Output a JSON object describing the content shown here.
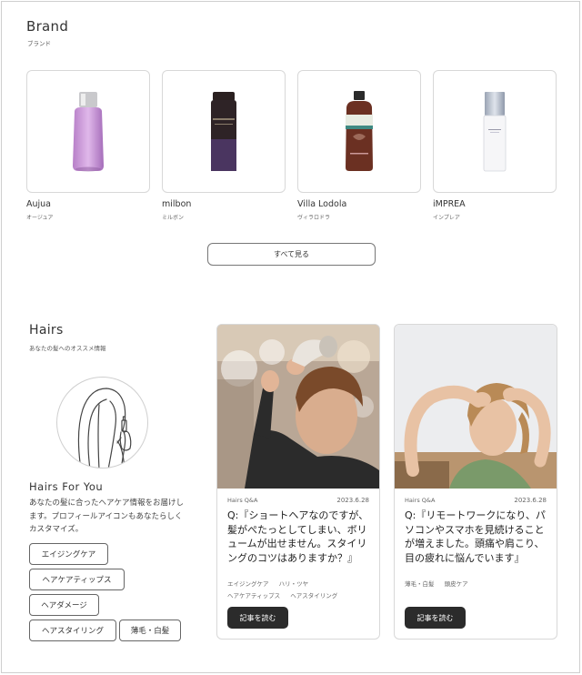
{
  "brand": {
    "title": "Brand",
    "subtitle": "ブランド",
    "items": [
      {
        "name": "Aujua",
        "kana": "オージュア"
      },
      {
        "name": "milbon",
        "kana": "ミルボン"
      },
      {
        "name": "Villa Lodola",
        "kana": "ヴィラロドラ"
      },
      {
        "name": "iMPREA",
        "kana": "インプレア"
      }
    ],
    "see_all": "すべて見る"
  },
  "hairs": {
    "title": "Hairs",
    "subtitle": "あなたの髪へのオススメ情報",
    "for_you_title": "Hairs For You",
    "for_you_desc": "あなたの髪に合ったヘアケア情報をお届けします。プロフィールアイコンもあなたらしくカスタマイズ。",
    "tags": [
      "エイジングケア",
      "ヘアケアティップス",
      "ヘアダメージ",
      "ヘアスタイリング",
      "薄毛・白髪"
    ]
  },
  "articles": [
    {
      "category": "Hairs Q&A",
      "date": "2023.6.28",
      "question": "Q:『ショートヘアなのですが、髪がぺたっとしてしまい、ボリュームが出せません。スタイリングのコツはありますか？』",
      "tag_rows": [
        [
          "エイジングケア",
          "ハリ・ツヤ"
        ],
        [
          "ヘアケアティップス",
          "ヘアスタイリング"
        ]
      ],
      "button": "記事を読む"
    },
    {
      "category": "Hairs Q&A",
      "date": "2023.6.28",
      "question": "Q:『リモートワークになり、パソコンやスマホを見続けることが増えました。頭痛や肩こり、目の疲れに悩んでいます』",
      "tag_rows": [
        [
          "薄毛・白髪",
          "頭皮ケア"
        ]
      ],
      "button": "記事を読む"
    }
  ]
}
